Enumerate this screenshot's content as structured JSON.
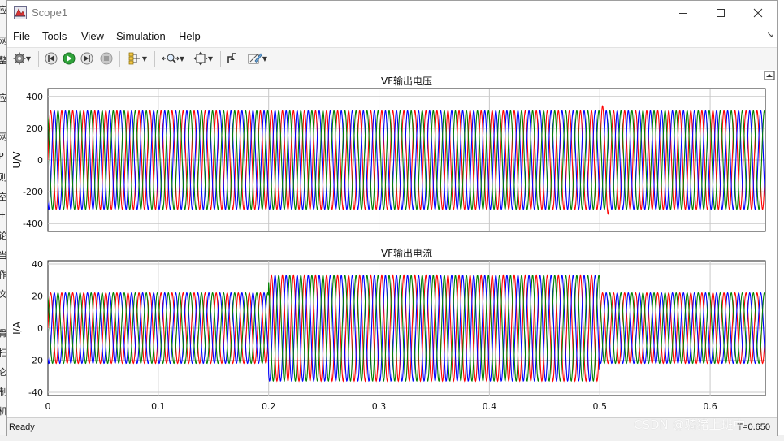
{
  "window": {
    "title": "Scope1"
  },
  "menu": {
    "items": [
      "File",
      "Tools",
      "View",
      "Simulation",
      "Help"
    ]
  },
  "toolbar": {
    "icons": [
      "gear-icon",
      "step-back-icon",
      "run-icon",
      "stop-icon",
      "signal-select-icon",
      "zoom-icon",
      "autoscale-icon",
      "style-icon",
      "measurement-icon"
    ]
  },
  "background_app": {
    "left_edge_text": [
      "应",
      "网",
      "整",
      "应",
      "网",
      "P",
      "则",
      "空",
      "+",
      "论",
      "当",
      "作",
      "文",
      "骨",
      "扫",
      "仑",
      "制",
      "机"
    ]
  },
  "plots": [
    {
      "title": "VF输出电压",
      "ylabel": "U/V",
      "yticks": [
        "400",
        "200",
        "0",
        "-200",
        "-400"
      ]
    },
    {
      "title": "VF输出电流",
      "ylabel": "I/A",
      "yticks": [
        "40",
        "20",
        "0",
        "-20",
        "-40"
      ]
    }
  ],
  "xticks": [
    "0",
    "0.1",
    "0.2",
    "0.3",
    "0.4",
    "0.5",
    "0.6"
  ],
  "status": {
    "left": "Ready",
    "right": "T=0.650"
  },
  "watermark": "CSDN @骑猪上班中",
  "colors": {
    "phase_a": "#ff0000",
    "phase_b": "#0000ff",
    "phase_c": "#008000",
    "plot_bg": "#ffffff",
    "grid": "#c8c8c8"
  },
  "chart_data": [
    {
      "type": "line",
      "title": "VF输出电压",
      "ylabel": "U/V",
      "xlim": [
        0,
        0.65
      ],
      "ylim": [
        -450,
        450
      ],
      "ytick_values": [
        -400,
        -200,
        0,
        200,
        400
      ],
      "frequency_hz": 100,
      "series": [
        {
          "color": "#ff0000",
          "phase_deg": 0,
          "amplitude": [
            [
              0,
              311
            ],
            [
              0.5,
              311
            ],
            [
              0.5,
              340
            ],
            [
              0.51,
              311
            ],
            [
              0.65,
              311
            ]
          ]
        },
        {
          "color": "#0000ff",
          "phase_deg": -120,
          "amplitude": [
            [
              0,
              311
            ],
            [
              0.65,
              311
            ]
          ]
        },
        {
          "color": "#008000",
          "phase_deg": 120,
          "amplitude": [
            [
              0,
              311
            ],
            [
              0.65,
              311
            ]
          ]
        }
      ]
    },
    {
      "type": "line",
      "title": "VF输出电流",
      "ylabel": "I/A",
      "xlim": [
        0,
        0.65
      ],
      "ylim": [
        -42,
        42
      ],
      "ytick_values": [
        -40,
        -20,
        0,
        20,
        40
      ],
      "frequency_hz": 100,
      "series": [
        {
          "color": "#ff0000",
          "phase_deg": 0,
          "amplitude": [
            [
              0,
              22
            ],
            [
              0.2,
              22
            ],
            [
              0.2,
              33
            ],
            [
              0.5,
              33
            ],
            [
              0.5,
              22
            ],
            [
              0.65,
              22
            ]
          ]
        },
        {
          "color": "#0000ff",
          "phase_deg": -120,
          "amplitude": [
            [
              0,
              22
            ],
            [
              0.2,
              22
            ],
            [
              0.2,
              33
            ],
            [
              0.5,
              33
            ],
            [
              0.5,
              22
            ],
            [
              0.65,
              22
            ]
          ]
        },
        {
          "color": "#008000",
          "phase_deg": 120,
          "amplitude": [
            [
              0,
              22
            ],
            [
              0.2,
              22
            ],
            [
              0.2,
              33
            ],
            [
              0.5,
              33
            ],
            [
              0.5,
              22
            ],
            [
              0.65,
              22
            ]
          ]
        }
      ]
    }
  ]
}
